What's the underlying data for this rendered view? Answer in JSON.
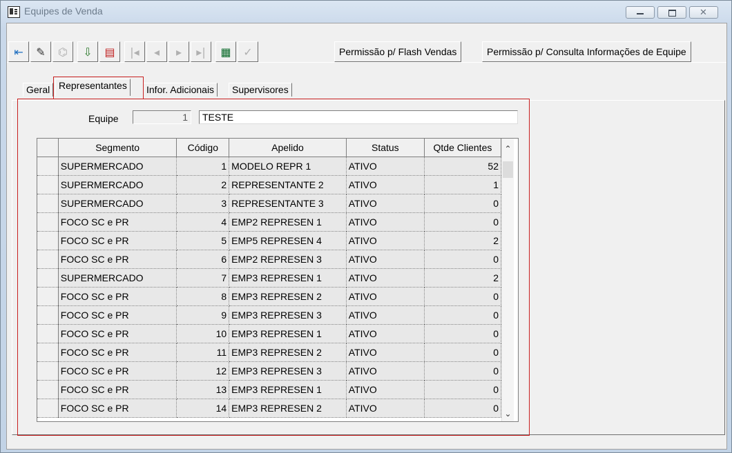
{
  "window": {
    "title": "Equipes de Venda"
  },
  "toolbar": {
    "buttons": [
      {
        "name": "exit",
        "glyph": "⇤"
      },
      {
        "name": "edit",
        "glyph": "✎"
      },
      {
        "name": "tree",
        "glyph": "⌬"
      },
      {
        "name": "save",
        "glyph": "⇩"
      },
      {
        "name": "print",
        "glyph": "▤"
      },
      {
        "name": "first",
        "glyph": "|◂"
      },
      {
        "name": "prev",
        "glyph": "◂"
      },
      {
        "name": "next",
        "glyph": "▸"
      },
      {
        "name": "last",
        "glyph": "▸|"
      },
      {
        "name": "list",
        "glyph": "▦"
      },
      {
        "name": "check",
        "glyph": "✓"
      }
    ],
    "flash_label": "Permissão p/ Flash Vendas",
    "consulta_label": "Permissão p/ Consulta Informações de Equipe"
  },
  "tabs": [
    "Geral",
    "Representantes",
    "Infor. Adicionais",
    "Supervisores"
  ],
  "equipe": {
    "label": "Equipe",
    "code": "1",
    "name": "TESTE"
  },
  "table": {
    "headers": [
      "Segmento",
      "Código",
      "Apelido",
      "Status",
      "Qtde Clientes"
    ],
    "rows": [
      [
        "SUPERMERCADO",
        "1",
        "MODELO REPR 1",
        "ATIVO",
        "52"
      ],
      [
        "SUPERMERCADO",
        "2",
        "REPRESENTANTE 2",
        "ATIVO",
        "1"
      ],
      [
        "SUPERMERCADO",
        "3",
        "REPRESENTANTE 3",
        "ATIVO",
        "0"
      ],
      [
        "FOCO SC e PR",
        "4",
        "EMP2 REPRESEN 1",
        "ATIVO",
        "0"
      ],
      [
        "FOCO SC e PR",
        "5",
        "EMP5 REPRESEN 4",
        "ATIVO",
        "2"
      ],
      [
        "FOCO SC e PR",
        "6",
        "EMP2 REPRESEN 3",
        "ATIVO",
        "0"
      ],
      [
        "SUPERMERCADO",
        "7",
        "EMP3 REPRESEN 1",
        "ATIVO",
        "2"
      ],
      [
        "FOCO SC e PR",
        "8",
        "EMP3 REPRESEN 2",
        "ATIVO",
        "0"
      ],
      [
        "FOCO SC e PR",
        "9",
        "EMP3 REPRESEN 3",
        "ATIVO",
        "0"
      ],
      [
        "FOCO SC e PR",
        "10",
        "EMP3 REPRESEN 1",
        "ATIVO",
        "0"
      ],
      [
        "FOCO SC e PR",
        "11",
        "EMP3 REPRESEN 2",
        "ATIVO",
        "0"
      ],
      [
        "FOCO SC e PR",
        "12",
        "EMP3 REPRESEN 3",
        "ATIVO",
        "0"
      ],
      [
        "FOCO SC e PR",
        "13",
        "EMP3 REPRESEN 1",
        "ATIVO",
        "0"
      ],
      [
        "FOCO SC e PR",
        "14",
        "EMP3 REPRESEN 2",
        "ATIVO",
        "0"
      ]
    ]
  },
  "colors": {
    "highlight": "#c81e1e"
  }
}
